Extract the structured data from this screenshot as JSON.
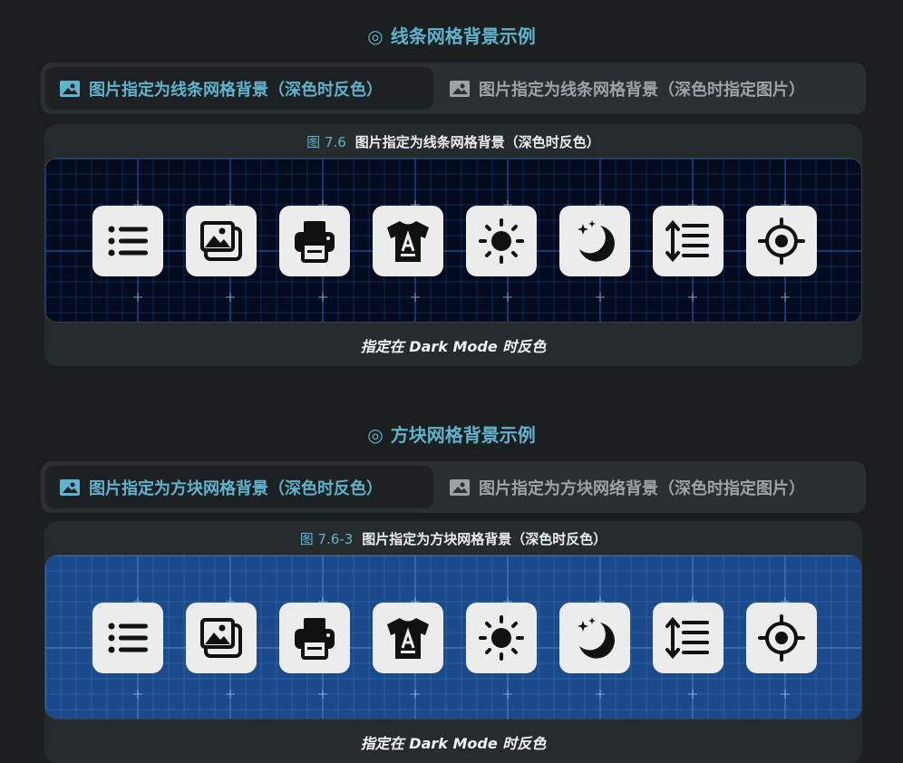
{
  "section1": {
    "heading": "线条网格背景示例",
    "heading_mark": "◎",
    "tabs": [
      {
        "label": "图片指定为线条网格背景（深色时反色）",
        "active": true
      },
      {
        "label": "图片指定为线条网格背景（深色时指定图片）",
        "active": false
      }
    ],
    "figure_number": "图 7.6",
    "figure_caption": "图片指定为线条网格背景（深色时反色）",
    "footnote": "指定在 Dark Mode 时反色",
    "panel_color": "#040b1f",
    "grid_color": "#1f4f9a"
  },
  "section2": {
    "heading": "方块网格背景示例",
    "heading_mark": "◎",
    "tabs": [
      {
        "label": "图片指定为方块网格背景（深色时反色）",
        "active": true
      },
      {
        "label": "图片指定为方块网络背景（深色时指定图片）",
        "active": false
      }
    ],
    "figure_number": "图 7.6-3",
    "figure_caption": "图片指定为方块网格背景（深色时反色）",
    "footnote": "指定在 Dark Mode 时反色",
    "panel_color": "#1a4a8c",
    "grid_color": "#4a78b8"
  },
  "icons": [
    "list-icon",
    "image-gallery-icon",
    "printer-icon",
    "t-shirt-icon",
    "sun-icon",
    "moon-stars-icon",
    "line-height-icon",
    "crosshair-icon"
  ],
  "accent_color": "#5fb3cc"
}
